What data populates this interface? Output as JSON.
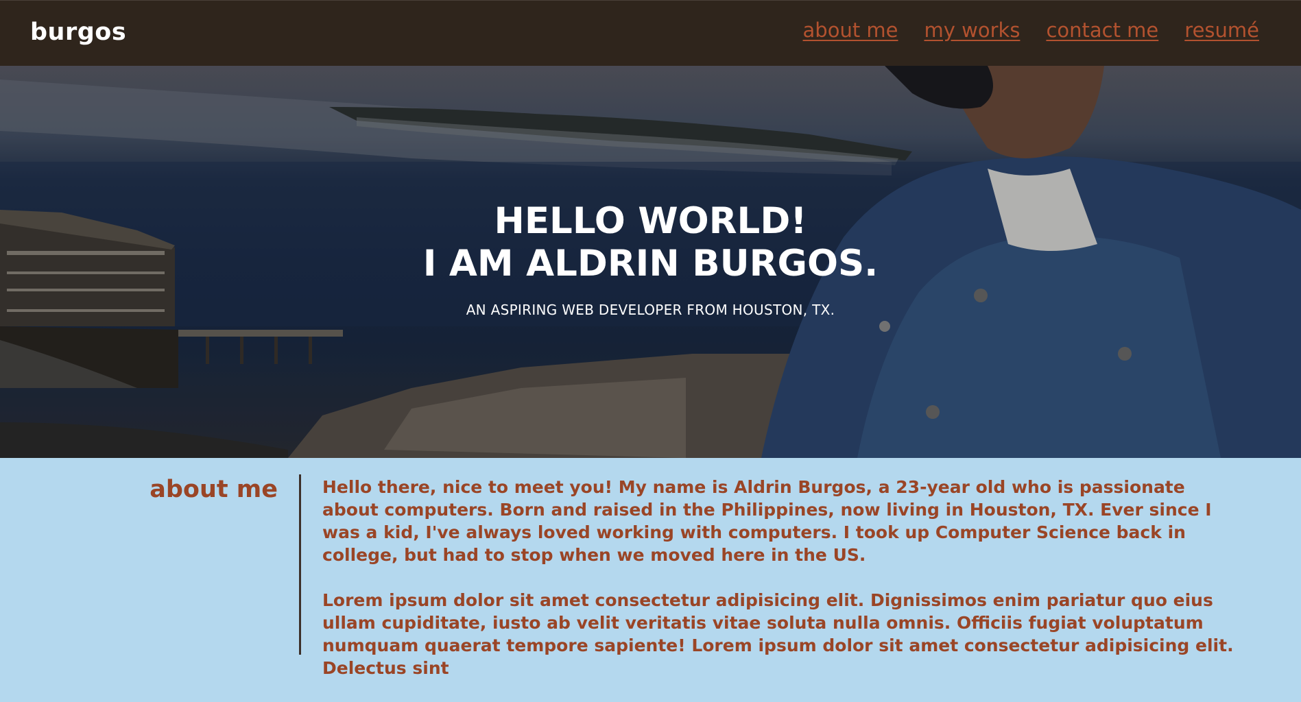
{
  "navbar": {
    "brand": "burgos",
    "links": [
      {
        "label": "about me"
      },
      {
        "label": "my works"
      },
      {
        "label": "contact me"
      },
      {
        "label": "resumé"
      }
    ]
  },
  "hero": {
    "title_line1": "HELLO WORLD!",
    "title_line2": "I AM ALDRIN BURGOS.",
    "subtitle": "AN ASPIRING WEB DEVELOPER FROM HOUSTON, TX."
  },
  "about": {
    "heading": "about me",
    "paragraphs": [
      "Hello there, nice to meet you! My name is Aldrin Burgos, a 23-year old who is passionate about computers. Born and raised in the Philippines, now living in Houston, TX. Ever since I was a kid, I've always loved working with computers. I took up Computer Science back in college, but had to stop when we moved here in the US.",
      "Lorem ipsum dolor sit amet consectetur adipisicing elit. Dignissimos enim pariatur quo eius ullam cupiditate, iusto ab velit veritatis vitae soluta nulla omnis. Officiis fugiat voluptatum numquam quaerat tempore sapiente! Lorem ipsum dolor sit amet consectetur adipisicing elit. Delectus sint"
    ]
  },
  "colors": {
    "navbar_bg": "#2f251c",
    "link": "#b3522f",
    "about_bg": "#b4d8ee",
    "about_text": "#9a4526"
  }
}
